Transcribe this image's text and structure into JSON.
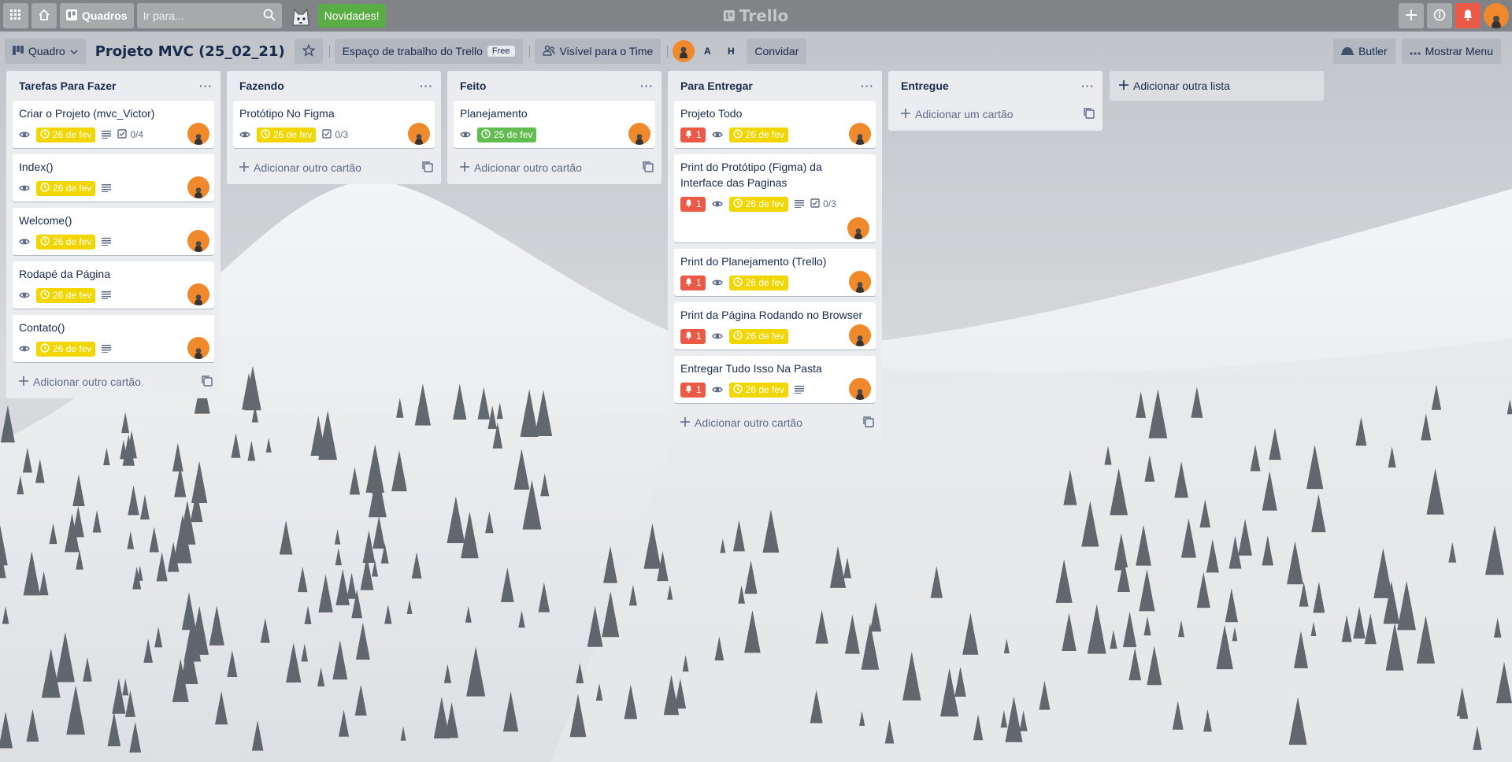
{
  "header": {
    "boards_label": "Quadros",
    "search_placeholder": "Ir para...",
    "news_label": "Novidades!",
    "logo_text": "Trello"
  },
  "board": {
    "view_label": "Quadro",
    "title": "Projeto MVC (25_02_21)",
    "workspace_label": "Espaço de trabalho do Trello",
    "workspace_badge": "Free",
    "visibility_label": "Visível para o Time",
    "members": [
      "A",
      "H"
    ],
    "invite_label": "Convidar",
    "butler_label": "Butler",
    "menu_label": "Mostrar Menu"
  },
  "lists": [
    {
      "title": "Tarefas Para Fazer",
      "add_label": "Adicionar outro cartão",
      "cards": [
        {
          "title": "Criar o Projeto (mvc_Victor)",
          "due": "26 de fev",
          "checklist": "0/4"
        },
        {
          "title": "Index()",
          "due": "26 de fev"
        },
        {
          "title": "Welcome()",
          "due": "26 de fev"
        },
        {
          "title": "Rodapé da Página",
          "due": "26 de fev"
        },
        {
          "title": "Contato()",
          "due": "26 de fev"
        }
      ]
    },
    {
      "title": "Fazendo",
      "add_label": "Adicionar outro cartão",
      "cards": [
        {
          "title": "Protótipo No Figma",
          "due": "26 de fev",
          "checklist": "0/3"
        }
      ]
    },
    {
      "title": "Feito",
      "add_label": "Adicionar outro cartão",
      "cards": [
        {
          "title": "Planejamento",
          "due": "25 de fev"
        }
      ]
    },
    {
      "title": "Para Entregar",
      "add_label": "Adicionar outro cartão",
      "cards": [
        {
          "title": "Projeto Todo",
          "alerts": "1",
          "due": "26 de fev"
        },
        {
          "title": "Print do Protótipo (Figma) da Interface das Paginas",
          "alerts": "1",
          "due": "26 de fev",
          "checklist": "0/3"
        },
        {
          "title": "Print do Planejamento (Trello)",
          "alerts": "1",
          "due": "26 de fev"
        },
        {
          "title": "Print da Página Rodando no Browser",
          "alerts": "1",
          "due": "26 de fev"
        },
        {
          "title": "Entregar Tudo Isso Na Pasta",
          "alerts": "1",
          "due": "26 de fev"
        }
      ]
    },
    {
      "title": "Entregue",
      "add_label": "Adicionar um cartão",
      "cards": []
    }
  ],
  "add_list_label": "Adicionar outra lista",
  "colors": {
    "due_pending": "#f2d600",
    "due_complete": "#61bd4f",
    "alert": "#eb5a46",
    "news": "#5aac44",
    "avatar": "#f0892c"
  }
}
